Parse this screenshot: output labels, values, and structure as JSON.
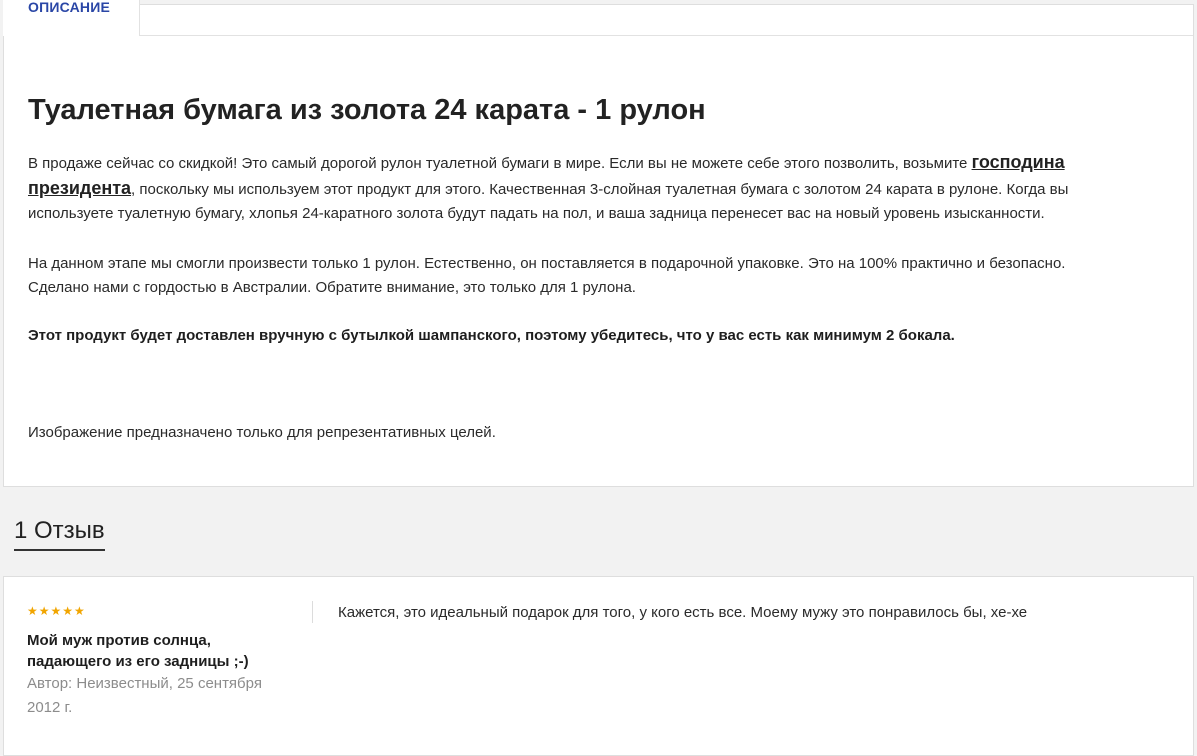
{
  "tabs": {
    "active_label": "ОПИСАНИЕ"
  },
  "product": {
    "title": "Туалетная бумага из золота 24 карата - 1 рулон",
    "p1_before_link": "В продаже сейчас со скидкой! Это самый дорогой рулон туалетной бумаги в мире. Если вы не можете себе этого позволить, возьмите ",
    "p1_link": "господина президента",
    "p1_after_link": ", поскольку мы используем этот продукт для этого. Качественная 3-слойная туалетная бумага с золотом 24 карата в рулоне. Когда вы используете туалетную бумагу, хлопья 24-каратного золота будут падать на пол, и ваша задница перенесет вас на новый уровень изысканности.",
    "p2": "На данном этапе мы смогли произвести только 1 рулон. Естественно, он поставляется в подарочной упаковке. Это на 100% практично и безопасно. Сделано нами с гордостью в Австралии. Обратите внимание, это только для 1 рулона.",
    "p3": "Этот продукт будет доставлен вручную с бутылкой шампанского, поэтому убедитесь, что у вас есть как минимум 2 бокала.",
    "p4": "Изображение предназначено только для репрезентативных целей."
  },
  "reviews": {
    "heading": "1 Отзыв",
    "items": [
      {
        "rating": 5,
        "stars": "★★★★★",
        "title": "Мой муж против солнца, падающего из его задницы ;-)",
        "meta": "Автор: Неизвестный, 25 сентября 2012 г.",
        "body": "Кажется, это идеальный подарок для того, у кого есть все. Моему мужу это понравилось бы, хе-хе"
      }
    ]
  },
  "colors": {
    "tab_accent": "#2a46a6",
    "star": "#f1a500",
    "meta_text": "#8c8c8c",
    "page_bg": "#f2f2f2"
  }
}
